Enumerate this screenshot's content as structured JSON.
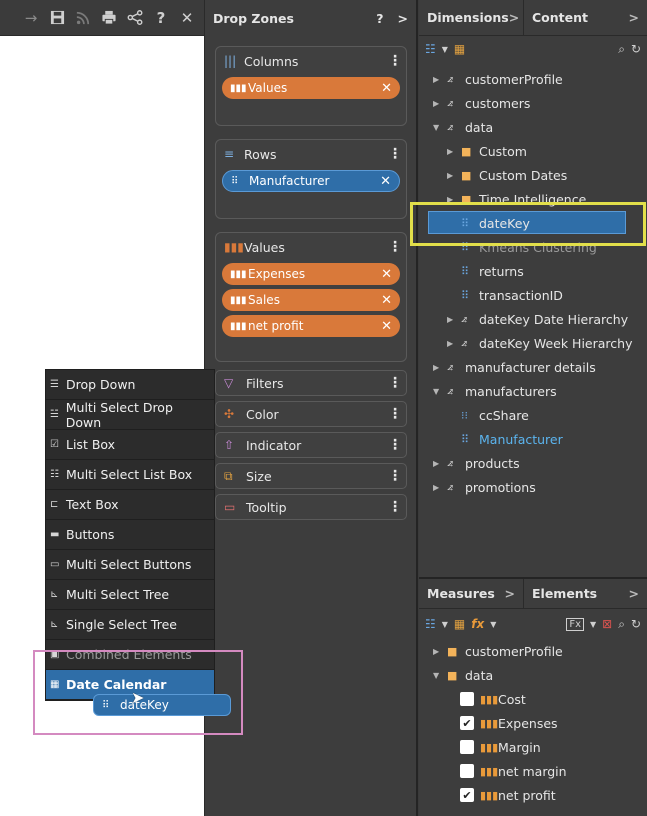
{
  "toolbar": {
    "icons": [
      "arrow-right-icon",
      "save-icon",
      "rss-icon",
      "print-icon",
      "share-icon",
      "help-icon",
      "close-icon"
    ]
  },
  "dropzones": {
    "title": "Drop Zones",
    "help": "?",
    "chevron": ">",
    "zones": [
      {
        "label": "Columns",
        "pills": [
          {
            "label": "Values",
            "color": "orange"
          }
        ]
      },
      {
        "label": "Rows",
        "pills": [
          {
            "label": "Manufacturer",
            "color": "blue"
          }
        ]
      },
      {
        "label": "Values",
        "pills": [
          {
            "label": "Expenses",
            "color": "orange"
          },
          {
            "label": "Sales",
            "color": "orange"
          },
          {
            "label": "net profit",
            "color": "orange"
          }
        ]
      }
    ],
    "mini": [
      "Filters",
      "Color",
      "Indicator",
      "Size",
      "Tooltip"
    ]
  },
  "dims": {
    "tab1": "Dimensions",
    "tab2": "Content",
    "chev": ">",
    "tree": [
      {
        "label": "customerProfile"
      },
      {
        "label": "customers"
      },
      {
        "label": "data"
      },
      {
        "label": "Custom"
      },
      {
        "label": "Custom Dates"
      },
      {
        "label": "Time Intelligence"
      },
      {
        "label": "dateKey"
      },
      {
        "label": "Kmeans Clustering"
      },
      {
        "label": "returns"
      },
      {
        "label": "transactionID"
      },
      {
        "label": "dateKey Date Hierarchy"
      },
      {
        "label": "dateKey Week Hierarchy"
      },
      {
        "label": "manufacturer details"
      },
      {
        "label": "manufacturers"
      },
      {
        "label": "ccShare"
      },
      {
        "label": "Manufacturer"
      },
      {
        "label": "products"
      },
      {
        "label": "promotions"
      }
    ]
  },
  "measures": {
    "tab1": "Measures",
    "tab2": "Elements",
    "chev": ">",
    "tree": [
      {
        "label": "customerProfile"
      },
      {
        "label": "data"
      },
      {
        "label": "Cost",
        "checked": false
      },
      {
        "label": "Expenses",
        "checked": true
      },
      {
        "label": "Margin",
        "checked": false
      },
      {
        "label": "net margin",
        "checked": false
      },
      {
        "label": "net profit",
        "checked": true
      }
    ]
  },
  "menu": {
    "items": [
      "Drop Down",
      "Multi Select Drop Down",
      "List Box",
      "Multi Select List Box",
      "Text Box",
      "Buttons",
      "Multi Select Buttons",
      "Multi Select Tree",
      "Single Select Tree",
      "Combined Elements",
      "Date Calendar"
    ]
  },
  "drag": {
    "label": "dateKey"
  },
  "colors": {
    "accent_blue": "#2f6ea8",
    "orange": "#d9793a",
    "highlight_yellow": "#e2df4a",
    "highlight_pink": "#d48ac0"
  }
}
